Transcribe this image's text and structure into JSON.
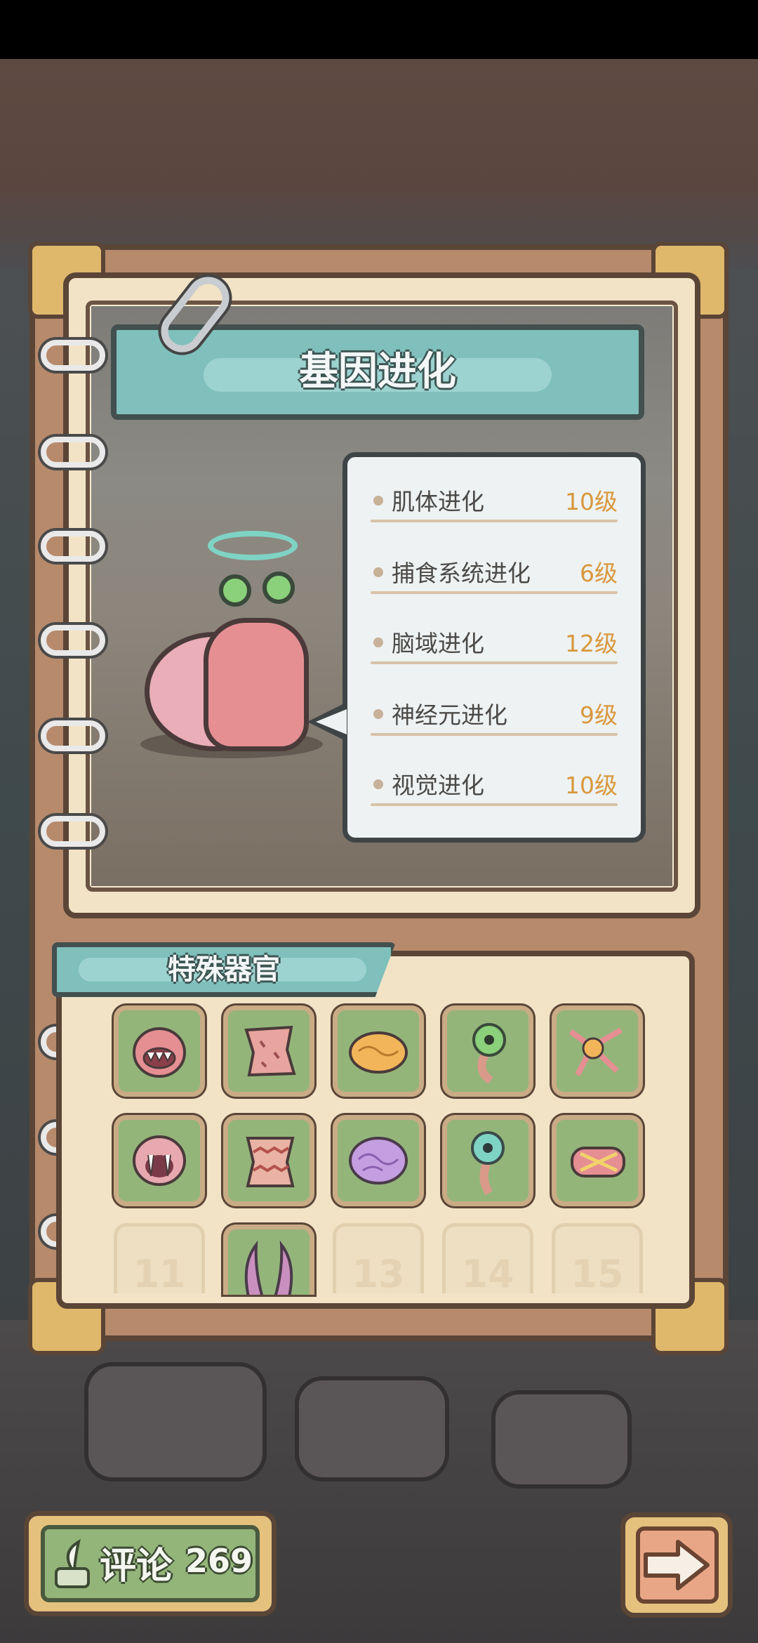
{
  "title": "基因进化",
  "stats": [
    {
      "name": "肌体进化",
      "level": "10级"
    },
    {
      "name": "捕食系统进化",
      "level": "6级"
    },
    {
      "name": "脑域进化",
      "level": "12级"
    },
    {
      "name": "神经元进化",
      "level": "9级"
    },
    {
      "name": "视觉进化",
      "level": "10级"
    }
  ],
  "organs": {
    "title": "特殊器官",
    "unlocked": [
      {
        "icon": "monster-mouth-icon"
      },
      {
        "icon": "skin-patch-icon"
      },
      {
        "icon": "orange-brain-icon"
      },
      {
        "icon": "eyestalk-icon"
      },
      {
        "icon": "neuron-icon"
      },
      {
        "icon": "fanged-mouth-icon"
      },
      {
        "icon": "striped-skin-icon"
      },
      {
        "icon": "purple-brain-icon"
      },
      {
        "icon": "blue-eyestalk-icon"
      },
      {
        "icon": "muscle-roll-icon"
      },
      {
        "icon": "horns-icon"
      }
    ],
    "locked_numbers": [
      "11",
      "13",
      "14",
      "15"
    ]
  },
  "comment": {
    "label": "评论",
    "count": "269"
  },
  "icons": {
    "next": "arrow-right-icon",
    "comment": "quill-icon"
  },
  "colors": {
    "level": "#d9983d",
    "banner": "#7fbfbc",
    "slot": "#93b57a"
  }
}
